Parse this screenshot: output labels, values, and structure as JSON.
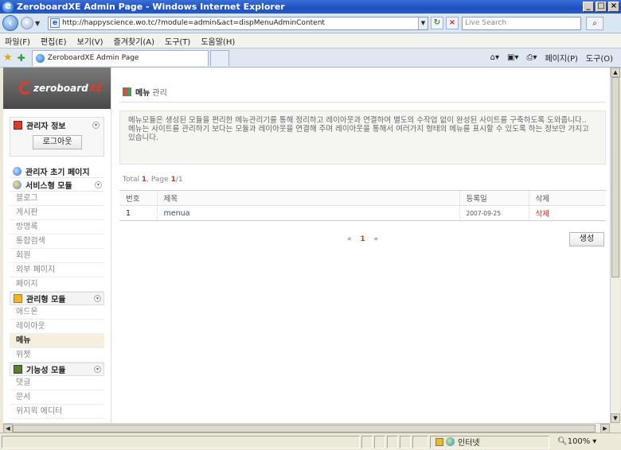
{
  "window": {
    "title": "ZeroboardXE Admin Page - Windows Internet Explorer",
    "min": "_",
    "max": "□",
    "close": "×"
  },
  "browser": {
    "url": "http://happyscience.wo.tc/?module=admin&act=dispMenuAdminContent",
    "search_placeholder": "Live Search",
    "menu": [
      "파일(F)",
      "편집(E)",
      "보기(V)",
      "즐겨찾기(A)",
      "도구(T)",
      "도움말(H)"
    ],
    "tab_title": "ZeroboardXE Admin Page",
    "page_menu": "페이지(P)",
    "tools_menu": "도구(O)",
    "status_zone": "인터넷",
    "zoom": "100%"
  },
  "sidebar": {
    "logo_text": "zeroboard",
    "logo_xe": "XE",
    "admin_info": "관리자 정보",
    "logout": "로그아웃",
    "admin_home": "관리자 초기 페이지",
    "service_head": "서비스형 모듈",
    "service_items": [
      "블로그",
      "게시판",
      "방명록",
      "통합검색",
      "회원",
      "외부 페이지",
      "페이지"
    ],
    "manage_head": "관리형 모듈",
    "manage_items": [
      "애드온",
      "레이아웃",
      "메뉴",
      "위젯"
    ],
    "function_head": "기능성 모듈",
    "function_items": [
      "댓글",
      "문서",
      "위지윅 에디터"
    ]
  },
  "main": {
    "title": "메뉴",
    "subtitle": "관리",
    "desc_1": "메뉴모듈은 생성된 모듈을 편리한 메뉴관리기를 통해 정리하고 레이아웃과 연결하여 별도의 수작업 없이 완성된 사이트를 구축하도록 도와줍니다..",
    "desc_2": "메뉴는 사이트를 관리하기 보다는 모듈과 레이아웃을 연결해 주며 레이아웃을 통해서 여러가지 형태의 메뉴를 표시할 수 있도록 하는 정보만 가지고 있습니다.",
    "total_label": "Total",
    "total_count": "1",
    "page_label": ", Page",
    "page_current": "1",
    "page_total": "/1",
    "columns": [
      "번호",
      "제목",
      "등록일",
      "삭제"
    ],
    "rows": [
      {
        "no": "1",
        "title": "menua",
        "date": "2007-09-25",
        "delete": "삭제"
      }
    ],
    "pager_prev": "«",
    "pager_current": "1",
    "pager_next": "»",
    "create": "생성"
  },
  "colors": {
    "accent_red": "#d0241c",
    "link_blue": "#2c4e9e",
    "ie_blue": "#1d4fbf"
  }
}
